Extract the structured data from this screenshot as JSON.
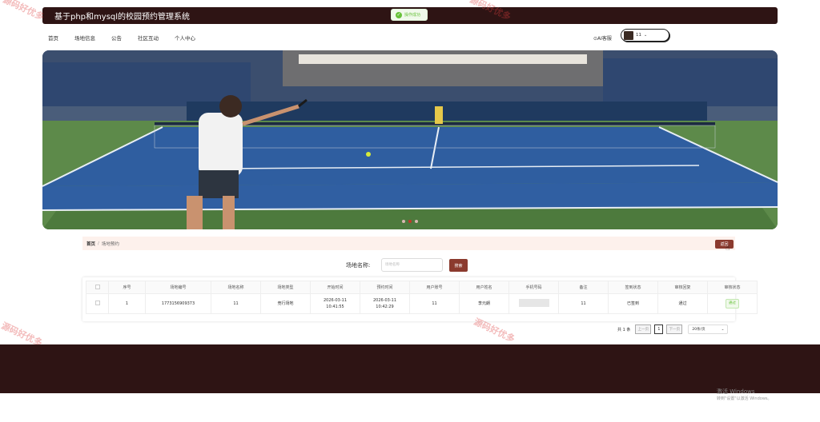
{
  "app": {
    "title": "基于php和mysql的校园预约管理系统"
  },
  "toast": {
    "message": "操作成功"
  },
  "nav": {
    "items": [
      "首页",
      "场地信息",
      "公告",
      "社区互动",
      "个人中心"
    ]
  },
  "header": {
    "ai_service": "⊙AI客服",
    "username": "11"
  },
  "breadcrumb": {
    "home": "首页",
    "separator": "/",
    "current": "场地预约"
  },
  "actions": {
    "back": "返回"
  },
  "search": {
    "label": "场地名称:",
    "placeholder": "场地名称",
    "button": "搜索"
  },
  "table": {
    "columns": [
      "序号",
      "场地编号",
      "场地名称",
      "场地类型",
      "开始时间",
      "预约时间",
      "用户账号",
      "用户姓名",
      "手机号码",
      "备注",
      "签到状态",
      "审核回复",
      "审核状态"
    ],
    "rows": [
      {
        "index": "1",
        "venue_no": "1773156909373",
        "venue_name": "11",
        "venue_type": "竞行场地",
        "start_date": "2026-03-11",
        "start_time": "10:41:55",
        "book_date": "2026-03-11",
        "book_time": "10:42:29",
        "account": "11",
        "user_name": "李元朗",
        "phone": "",
        "remark": "11",
        "checkin": "已签到",
        "reply": "通过",
        "status": "通过"
      }
    ]
  },
  "pagination": {
    "total": "共 1 条",
    "prev": "上一页",
    "page": "1",
    "next": "下一页",
    "size": "20条/页"
  },
  "watermark": "源码好优多",
  "os_overlay": {
    "line1": "激活 Windows",
    "line2": "转到\"设置\"以激活 Windows。"
  },
  "colors": {
    "brand_dark": "#2e1414",
    "accent": "#8b3a2e",
    "success": "#67c23a"
  }
}
